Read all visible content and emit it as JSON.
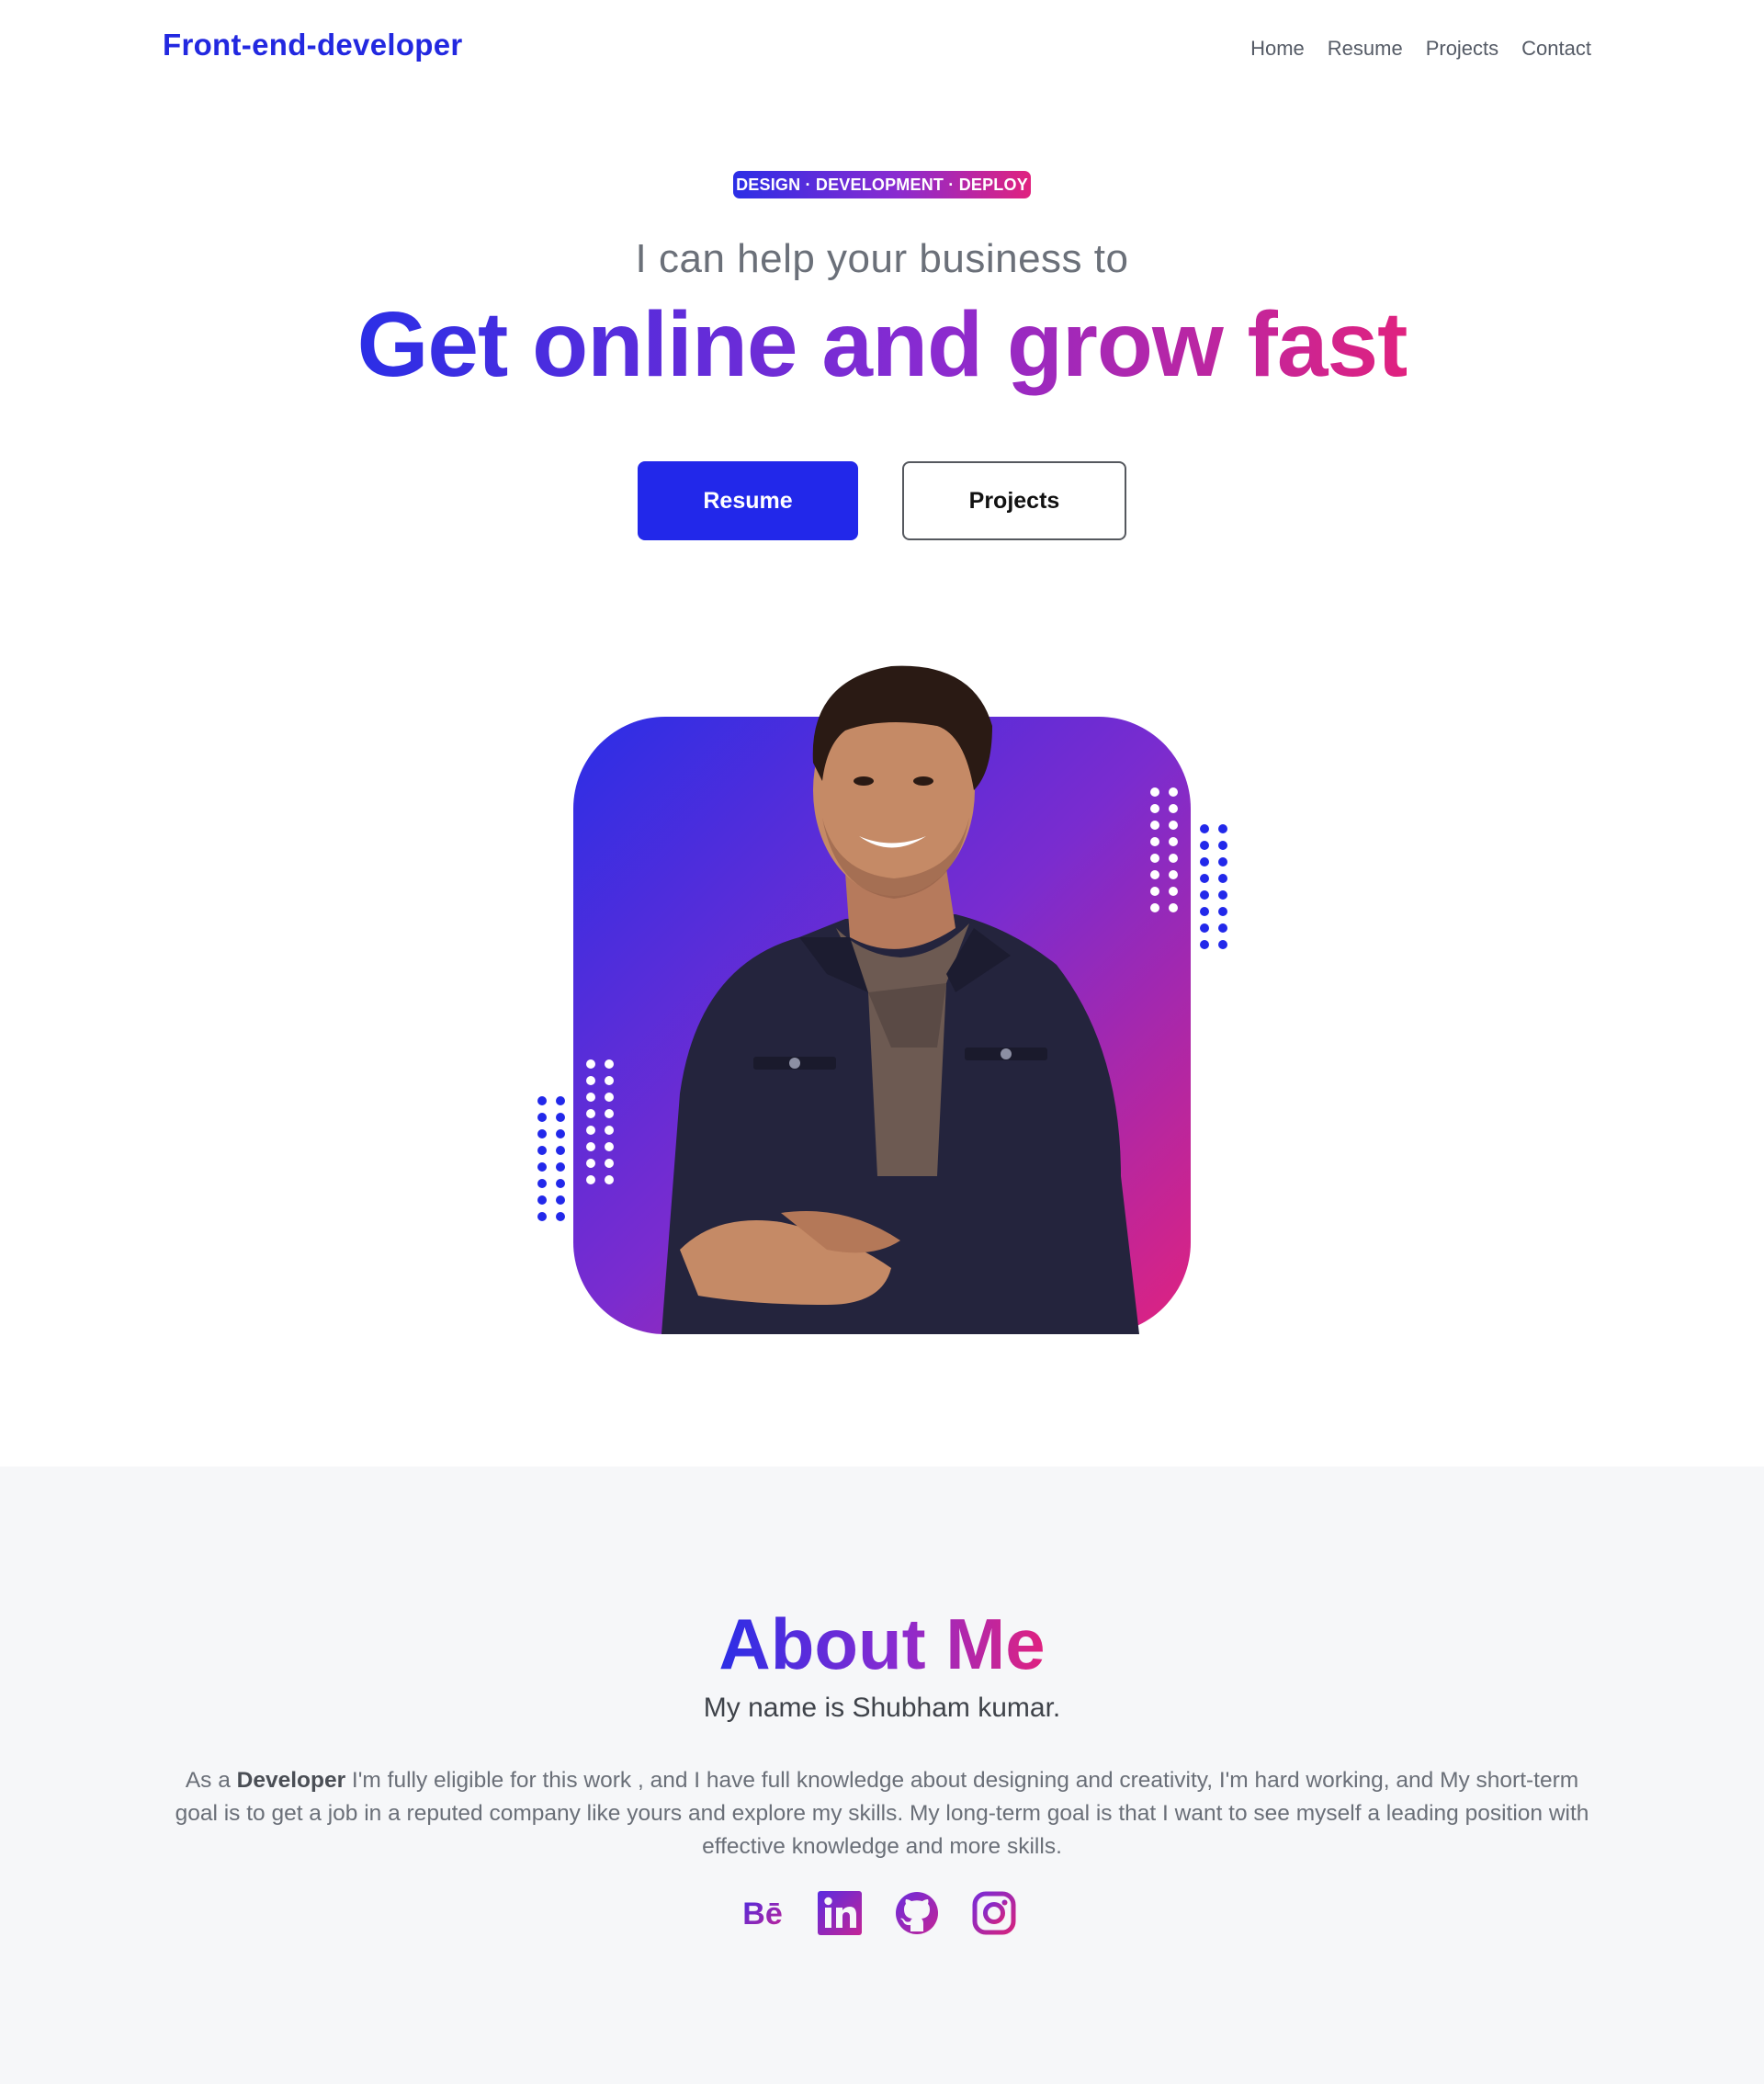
{
  "header": {
    "brand": "Front-end-developer",
    "nav": [
      "Home",
      "Resume",
      "Projects",
      "Contact"
    ]
  },
  "hero": {
    "tag": "DESIGN · DEVELOPMENT · DEPLOY",
    "subheading": "I can help your business to",
    "title": "Get online and grow fast",
    "buttons": {
      "primary": "Resume",
      "secondary": "Projects"
    }
  },
  "about": {
    "title": "About Me",
    "subtitle": "My name is Shubham kumar.",
    "body_prefix": "As a ",
    "body_bold": "Developer",
    "body_rest": " I'm fully eligible for this work , and I have full knowledge about designing and creativity, I'm hard working, and My short-term goal is to get a job in a reputed company like yours and explore my skills. My long-term goal is that I want to see myself a leading position with effective knowledge and more skills.",
    "socials": [
      "behance-icon",
      "linkedin-icon",
      "github-icon",
      "instagram-icon"
    ],
    "behance_text": "Bē"
  },
  "colors": {
    "primary": "#2228ea",
    "gradient_start": "#2b2ee6",
    "gradient_mid": "#8a2bd0",
    "gradient_end": "#e0227f",
    "about_bg": "#f6f7f9"
  }
}
